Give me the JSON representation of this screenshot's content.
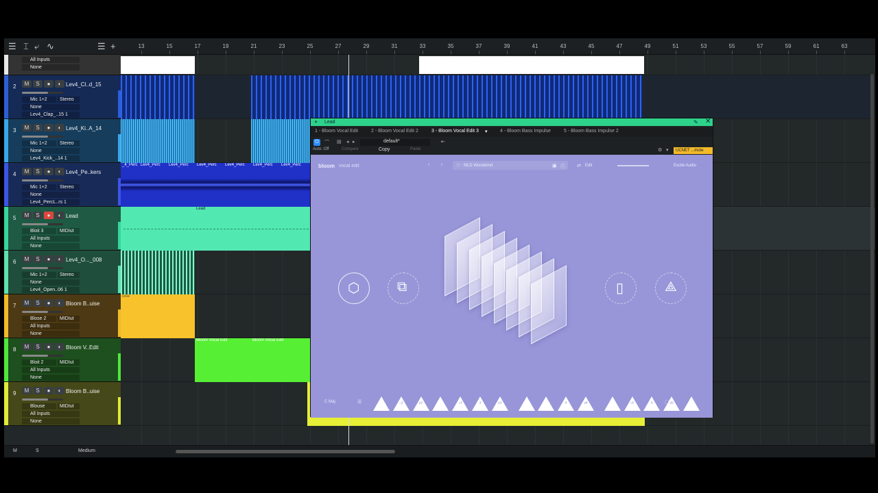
{
  "toolbar": {
    "menu": "☰",
    "tools": [
      "⌶",
      "⤶",
      "∿"
    ],
    "list": "☰",
    "add": "+"
  },
  "ruler": {
    "ticks": [
      "13",
      "15",
      "17",
      "19",
      "21",
      "23",
      "25",
      "27",
      "29",
      "31",
      "33",
      "35",
      "37",
      "39",
      "41",
      "43",
      "45",
      "47",
      "49",
      "51",
      "53",
      "55",
      "57",
      "59",
      "61",
      "63"
    ]
  },
  "tracks": [
    {
      "num": "",
      "name": "",
      "rows": [
        "All Inputs",
        "None"
      ],
      "color": "#333",
      "stripe": "#e8e8e8"
    },
    {
      "num": "2",
      "name": "Lev4_Cl..d_15",
      "rows": [
        "Mic 1+2",
        "None",
        "Lev4_Clap_..15 1"
      ],
      "color": "#152a55",
      "stripe": "#2c5fd6",
      "tag": "Stereo"
    },
    {
      "num": "3",
      "name": "Lev4_Ki..A_14",
      "rows": [
        "Mic 1+2",
        "None",
        "Lev4_Kick_..14 1"
      ],
      "color": "#163d5c",
      "stripe": "#38a7e8",
      "tag": "Stereo"
    },
    {
      "num": "4",
      "name": "Lev4_Pe..kers",
      "rows": [
        "Mic 1+2",
        "None",
        "Lev4_PercL..rs 1"
      ],
      "color": "#182b58",
      "stripe": "#3d54e6",
      "tag": "Stereo"
    },
    {
      "num": "5",
      "name": "Lead",
      "rows": [
        "Bloit 3",
        "All Inputs",
        "None"
      ],
      "color": "#1e5a44",
      "stripe": "#35d69c",
      "tag": "MIDIut"
    },
    {
      "num": "6",
      "name": "Lev4_O..._008",
      "rows": [
        "Mic 1+2",
        "None",
        "Lev4_Open..06 1"
      ],
      "color": "#1f4f3c",
      "stripe": "#5fe0b0",
      "tag": "Stereo"
    },
    {
      "num": "7",
      "name": "Bloom B..uise",
      "rows": [
        "Blose 2",
        "All Inputs",
        "None"
      ],
      "color": "#4d3a14",
      "stripe": "#f2b92a",
      "tag": "MIDIut"
    },
    {
      "num": "8",
      "name": "Bloom V..Edit",
      "rows": [
        "Bloit 2",
        "All Inputs",
        "None"
      ],
      "color": "#1e4f1e",
      "stripe": "#4fe83a",
      "tag": "MIDIut"
    },
    {
      "num": "9",
      "name": "Bloom B..uise",
      "rows": [
        "Blouse",
        "All Inputs",
        "None"
      ],
      "color": "#454818",
      "stripe": "#e0ea3a",
      "tag": "MIDIut"
    }
  ],
  "clips": {
    "lead": "Lead",
    "bve1": "Bloom Vocal Edit",
    "bve2": "Bloom Vocal Edit",
    "bbi": "uise",
    "perc": [
      "_4_Perc",
      "Lev4_Perc",
      "Lev4_Perc",
      "Lev4_Perc",
      "Lev4_Perc",
      "Lev4_Perc",
      "Lev4_Perc",
      "Lev4_Perc"
    ]
  },
  "statusbar": {
    "m": "M",
    "s": "S",
    "zoom": "Medium"
  },
  "plugin": {
    "title": "Lead",
    "tabs": [
      "1 - Bloom Vocal Edit",
      "2 - Bloom Vocal Edit 2",
      "3 - Bloom Vocal Edit 3",
      "4 - Bloom Bass Impulse",
      "5 - Bloom Bass Impulse 2"
    ],
    "auto": "Auto: Off",
    "compare": "Compare",
    "copy": "Copy",
    "paste": "Paste",
    "preset": "default*",
    "remote": "UCNET ...mote",
    "brand": "bloom",
    "brand2": "vocal edit",
    "presetName": "MLD Woodwind",
    "edit": "Edit",
    "company": "Excite Audio",
    "key": "C Maj",
    "keys": [
      "",
      "♭2",
      "♯2",
      "",
      "♭3",
      "3",
      "♯3",
      "",
      "",
      "4",
      "♯4",
      "",
      "♭5",
      "5",
      "♯5",
      ""
    ]
  },
  "colors": {
    "bloom_bg": "#9896d8",
    "accent": "#2ed38b",
    "remote": "#f2b92a"
  }
}
